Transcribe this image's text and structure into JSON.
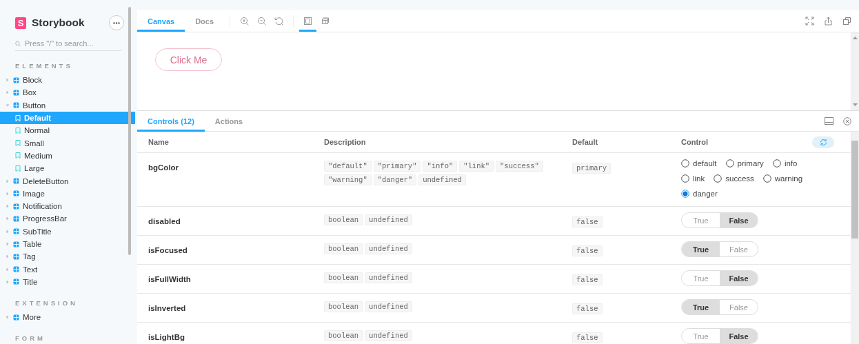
{
  "sidebar": {
    "brand": {
      "logo": "S",
      "name": "Storybook"
    },
    "search": {
      "placeholder": "Press \"/\" to search..."
    },
    "sections": [
      {
        "title": "ELEMENTS",
        "items": [
          {
            "kind": "component",
            "label": "Block",
            "expanded": false,
            "selected": false
          },
          {
            "kind": "component",
            "label": "Box",
            "expanded": false,
            "selected": false
          },
          {
            "kind": "component",
            "label": "Button",
            "expanded": true,
            "selected": false,
            "children": [
              {
                "kind": "story",
                "label": "Default",
                "selected": true
              },
              {
                "kind": "story",
                "label": "Normal",
                "selected": false
              },
              {
                "kind": "story",
                "label": "Small",
                "selected": false
              },
              {
                "kind": "story",
                "label": "Medium",
                "selected": false
              },
              {
                "kind": "story",
                "label": "Large",
                "selected": false
              }
            ]
          },
          {
            "kind": "component",
            "label": "DeleteButton",
            "expanded": false,
            "selected": false
          },
          {
            "kind": "component",
            "label": "Image",
            "expanded": false,
            "selected": false
          },
          {
            "kind": "component",
            "label": "Notification",
            "expanded": false,
            "selected": false
          },
          {
            "kind": "component",
            "label": "ProgressBar",
            "expanded": false,
            "selected": false
          },
          {
            "kind": "component",
            "label": "SubTitle",
            "expanded": false,
            "selected": false
          },
          {
            "kind": "component",
            "label": "Table",
            "expanded": false,
            "selected": false
          },
          {
            "kind": "component",
            "label": "Tag",
            "expanded": false,
            "selected": false
          },
          {
            "kind": "component",
            "label": "Text",
            "expanded": false,
            "selected": false
          },
          {
            "kind": "component",
            "label": "Title",
            "expanded": false,
            "selected": false
          }
        ]
      },
      {
        "title": "EXTENSION",
        "items": [
          {
            "kind": "component",
            "label": "More",
            "expanded": false,
            "selected": false
          }
        ]
      },
      {
        "title": "FORM"
      }
    ]
  },
  "preview": {
    "tabs": [
      {
        "label": "Canvas",
        "selected": true
      },
      {
        "label": "Docs",
        "selected": false
      }
    ],
    "tools": [
      {
        "kind": "zoom-in",
        "selected": false
      },
      {
        "kind": "zoom-out",
        "selected": false
      },
      {
        "kind": "zoom-reset",
        "selected": false
      },
      {
        "kind": "background",
        "selected": true
      },
      {
        "kind": "outline",
        "selected": false
      }
    ],
    "actions": [
      {
        "kind": "fullscreen"
      },
      {
        "kind": "share"
      },
      {
        "kind": "copy"
      }
    ],
    "story_button": {
      "label": "Click Me"
    }
  },
  "addons": {
    "tabs": [
      {
        "label": "Controls (12)",
        "selected": true
      },
      {
        "label": "Actions",
        "selected": false
      }
    ],
    "table": {
      "columns": [
        "Name",
        "Description",
        "Default",
        "Control"
      ],
      "rows": [
        {
          "name": "bgColor",
          "types": [
            "\"default\"",
            "\"primary\"",
            "\"info\"",
            "\"link\"",
            "\"success\"",
            "\"warning\"",
            "\"danger\"",
            "undefined"
          ],
          "default": "primary",
          "control": {
            "kind": "radio",
            "options": [
              {
                "label": "default",
                "selected": false
              },
              {
                "label": "primary",
                "selected": false
              },
              {
                "label": "info",
                "selected": false
              },
              {
                "label": "link",
                "selected": false
              },
              {
                "label": "success",
                "selected": false
              },
              {
                "label": "warning",
                "selected": false
              },
              {
                "label": "danger",
                "selected": true
              }
            ]
          }
        },
        {
          "name": "disabled",
          "types": [
            "boolean",
            "undefined"
          ],
          "default": "false",
          "control": {
            "kind": "toggle",
            "options": [
              {
                "label": "True",
                "selected": false
              },
              {
                "label": "False",
                "selected": true
              }
            ]
          }
        },
        {
          "name": "isFocused",
          "types": [
            "boolean",
            "undefined"
          ],
          "default": "false",
          "control": {
            "kind": "toggle",
            "options": [
              {
                "label": "True",
                "selected": true
              },
              {
                "label": "False",
                "selected": false
              }
            ]
          }
        },
        {
          "name": "isFullWidth",
          "types": [
            "boolean",
            "undefined"
          ],
          "default": "false",
          "control": {
            "kind": "toggle",
            "options": [
              {
                "label": "True",
                "selected": false
              },
              {
                "label": "False",
                "selected": true
              }
            ]
          }
        },
        {
          "name": "isInverted",
          "types": [
            "boolean",
            "undefined"
          ],
          "default": "false",
          "control": {
            "kind": "toggle",
            "options": [
              {
                "label": "True",
                "selected": true
              },
              {
                "label": "False",
                "selected": false
              }
            ]
          }
        },
        {
          "name": "isLightBg",
          "types": [
            "boolean",
            "undefined"
          ],
          "default": "false",
          "control": {
            "kind": "toggle",
            "options": [
              {
                "label": "True",
                "selected": false
              },
              {
                "label": "False",
                "selected": true
              }
            ]
          }
        }
      ]
    }
  }
}
